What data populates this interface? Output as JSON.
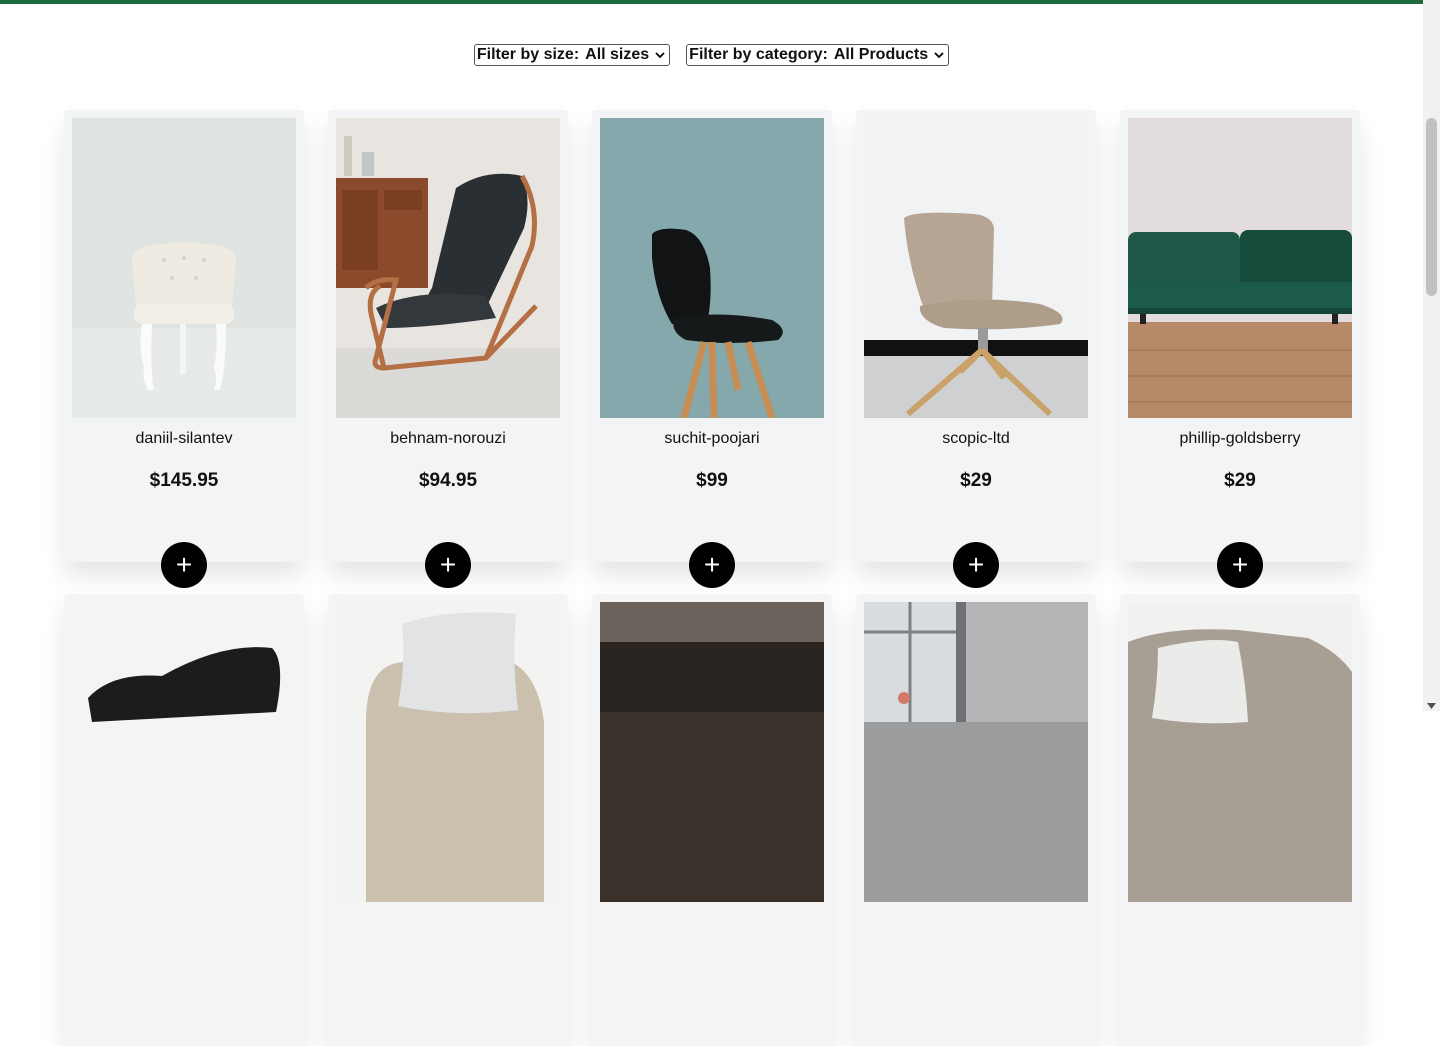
{
  "filters": {
    "size": {
      "label": "Filter by size:",
      "selected": "All sizes"
    },
    "category": {
      "label": "Filter by category:",
      "selected": "All Products"
    }
  },
  "colors": {
    "accent_bar": "#1d6a3a",
    "card_bg": "#f3f4f6",
    "add_button": "#000000"
  },
  "products": [
    {
      "name": "daniil-silantev",
      "price": "$145.95",
      "add_label": "+"
    },
    {
      "name": "behnam-norouzi",
      "price": "$94.95",
      "add_label": "+"
    },
    {
      "name": "suchit-poojari",
      "price": "$99",
      "add_label": "+"
    },
    {
      "name": "scopic-ltd",
      "price": "$29",
      "add_label": "+"
    },
    {
      "name": "phillip-goldsberry",
      "price": "$29",
      "add_label": "+"
    }
  ]
}
